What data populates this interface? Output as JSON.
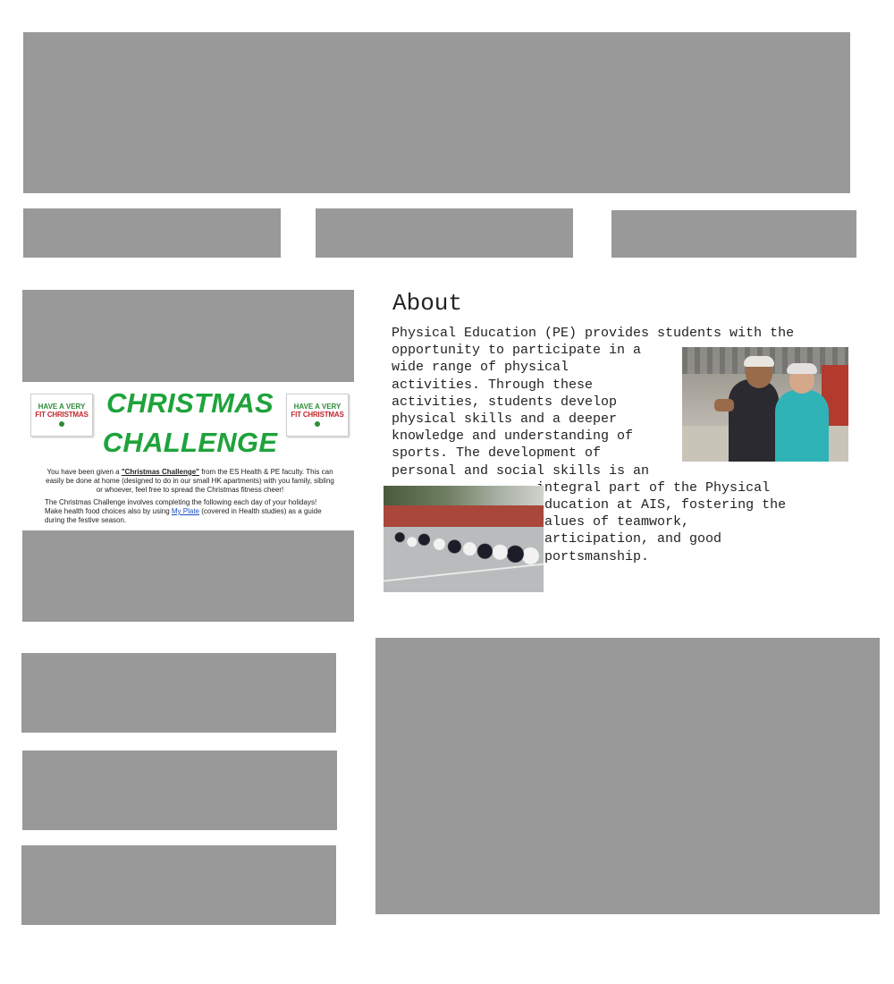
{
  "flyer": {
    "card_line1": "HAVE A VERY",
    "card_line2": "FIT CHRISTMAS",
    "title_line1": "CHRISTMAS",
    "title_line2": "CHALLENGE",
    "para1_prefix": "You have been given a ",
    "para1_bold": "\"Christmas Challenge\"",
    "para1_suffix": " from the ES Health & PE faculty. This can easily be done at home (designed to do in our small HK apartments) with you family, sibling or whoever, feel free to spread the Christmas fitness cheer!",
    "para2_line1": "The Christmas Challenge involves completing the following each day of your holidays!",
    "para2_prefix": "Make health food choices also by using ",
    "para2_link": "My Plate",
    "para2_suffix": " (covered in Health studies) as a guide during the festive season."
  },
  "about": {
    "heading": "About",
    "body": "Physical Education (PE) provides students with the\nopportunity to participate in a\nwide range of physical\nactivities. Through these\nactivities, students develop\nphysical skills and a deeper\nknowledge and understanding of\nsports. The development of\npersonal and social skills is an\n                  integral part of the Physical\n                  Education at AIS, fostering the\n                  values of teamwork,\n                  participation, and good\n                  sportsmanship."
  },
  "colors": {
    "placeholder": "#999999",
    "flyer_title": "#1ea33b",
    "card_red": "#c0262d",
    "link_blue": "#1a4fc4"
  }
}
